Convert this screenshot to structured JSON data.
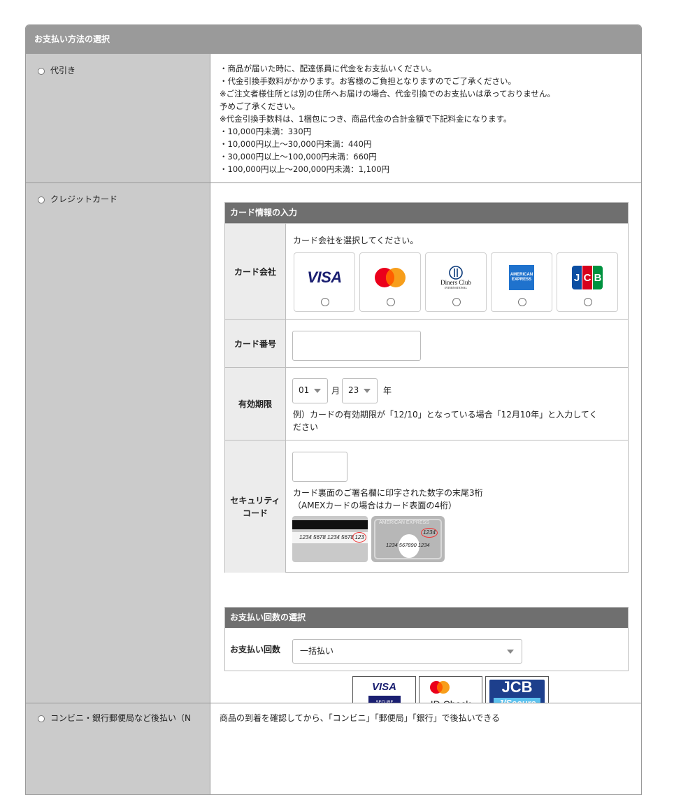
{
  "header": {
    "title": "お支払い方法の選択"
  },
  "cod": {
    "label": "代引き",
    "lines": "・商品が届いた時に、配達係員に代金をお支払いください。\n・代金引換手数料がかかります。お客様のご負担となりますのでご了承ください。\n※ご注文者様住所とは別の住所へお届けの場合、代金引換でのお支払いは承っておりません。\n予めご了承ください。\n※代金引換手数料は、1梱包につき、商品代金の合計金額で下記料金になります。\n・10,000円未満：330円\n・10,000円以上～30,000円未満：440円\n・30,000円以上～100,000円未満：660円\n・100,000円以上～200,000円未満：1,100円"
  },
  "credit": {
    "label": "クレジットカード",
    "card_info": {
      "title": "カード情報の入力",
      "company_label": "カード会社",
      "company_prompt": "カード会社を選択してください。",
      "brands": [
        {
          "name": "visa-logo",
          "text": "VISA"
        },
        {
          "name": "mastercard-logo",
          "text": ""
        },
        {
          "name": "diners-logo",
          "text": "Diners Club",
          "sub": "INTERNATIONAL"
        },
        {
          "name": "amex-logo",
          "text": "AMERICAN",
          "sub": "EXPRESS"
        },
        {
          "name": "jcb-logo",
          "text": "JCB"
        }
      ],
      "number_label": "カード番号",
      "expiry_label": "有効期限",
      "expiry_month": "01",
      "month_unit": "月",
      "expiry_year": "23",
      "year_unit": "年",
      "expiry_note": "例）カードの有効期限が「12/10」となっている場合「12月10年」と入力してく\nださい",
      "cvc_label": "セキュリティ\nコード",
      "cvc_note": "カード裏面のご署名欄に印字された数字の末尾3桁\n（AMEXカードの場合はカード表面の4桁）",
      "cvc_sample_back": "1234 5678 1234 5678",
      "cvc_sample_back_code": "123",
      "cvc_sample_amex_header": "AMERICAN EXPRESS",
      "cvc_sample_amex_code": "1234",
      "cvc_sample_amex_number": "1234 567890 1234"
    },
    "installments": {
      "title": "お支払い回数の選択",
      "label": "お支払い回数",
      "selected": "一括払い"
    },
    "secure_badges": {
      "visa": "VISA",
      "visa_sub": "SECURE",
      "mc": "ID Check",
      "jcb": "JCB",
      "jcb_sub": "J/Secure"
    }
  },
  "conv": {
    "label": "コンビニ・銀行郵便局など後払い（N",
    "text": "商品の到着を確認してから、「コンビニ」「郵便局」「銀行」で後払いできる"
  },
  "colors": {
    "header": "#9a9a9a",
    "subheader": "#6f6f6f",
    "left_cell": "#cbcbcb",
    "visa": "#1a1f71",
    "mc_red": "#eb001b",
    "mc_orange": "#f79e1b",
    "jcb_blue": "#0b4ea2"
  }
}
